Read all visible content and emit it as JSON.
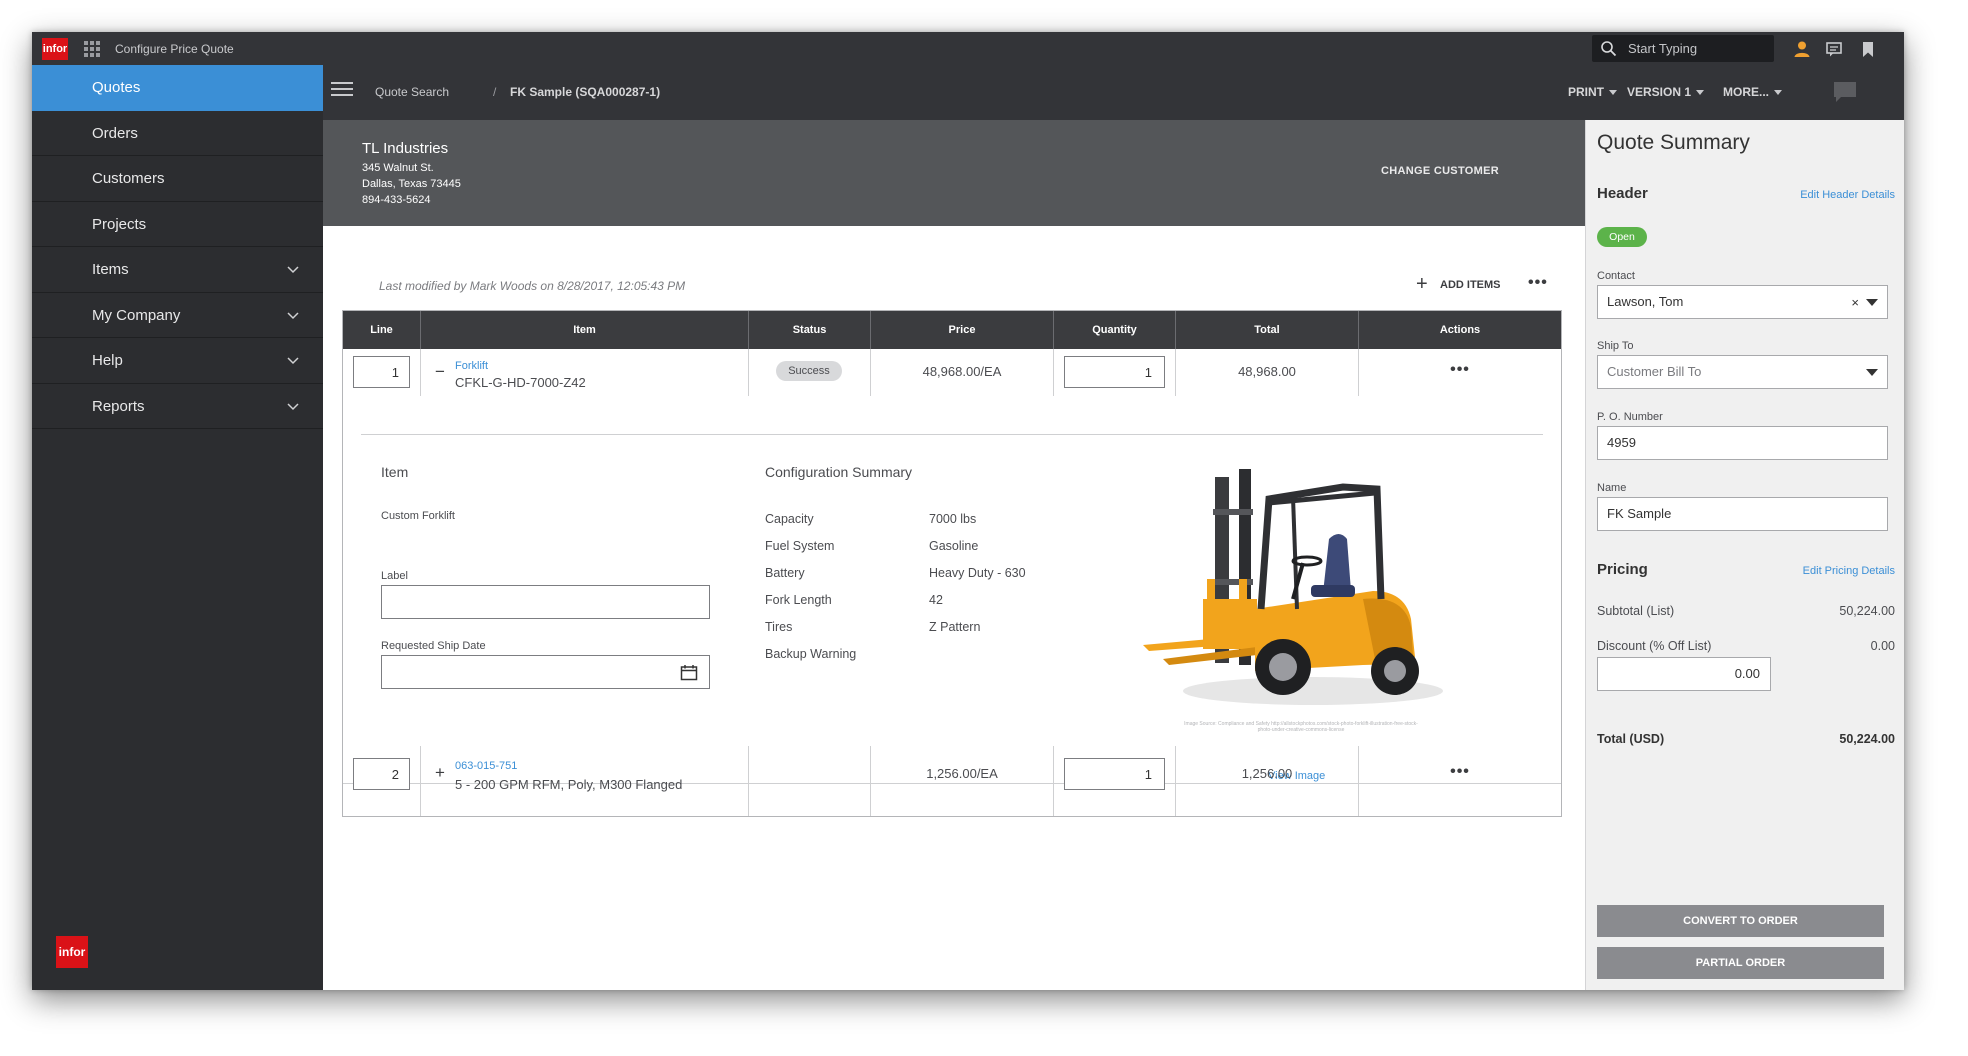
{
  "topbar": {
    "logo": "infor",
    "app_title": "Configure Price Quote",
    "search_placeholder": "Start Typing"
  },
  "sidebar": {
    "items": [
      {
        "label": "Quotes",
        "active": true,
        "expandable": false
      },
      {
        "label": "Orders",
        "active": false,
        "expandable": false
      },
      {
        "label": "Customers",
        "active": false,
        "expandable": false
      },
      {
        "label": "Projects",
        "active": false,
        "expandable": false
      },
      {
        "label": "Items",
        "active": false,
        "expandable": true
      },
      {
        "label": "My Company",
        "active": false,
        "expandable": true
      },
      {
        "label": "Help",
        "active": false,
        "expandable": true
      },
      {
        "label": "Reports",
        "active": false,
        "expandable": true
      }
    ],
    "logo": "infor"
  },
  "breadcrumb": {
    "parent": "Quote Search",
    "separator": "/",
    "current": "FK Sample (SQA000287-1)",
    "actions": [
      "PRINT",
      "VERSION 1",
      "MORE..."
    ]
  },
  "customer": {
    "name": "TL Industries",
    "address1": "345 Walnut St.",
    "address2": "Dallas, Texas 73445",
    "phone": "894-433-5624",
    "change_label": "CHANGE CUSTOMER"
  },
  "quote": {
    "last_modified": "Last modified by Mark Woods on 8/28/2017, 12:05:43 PM",
    "add_items_label": "ADD ITEMS",
    "more_label": "•••",
    "columns": [
      "Line",
      "Item",
      "Status",
      "Price",
      "Quantity",
      "Total",
      "Actions"
    ],
    "lines": [
      {
        "line": "1",
        "expander": "−",
        "item_link": "Forklift",
        "item_desc": "CFKL-G-HD-7000-Z42",
        "status": "Success",
        "price": "48,968.00/EA",
        "quantity": "1",
        "total": "48,968.00",
        "actions": "•••"
      },
      {
        "line": "2",
        "expander": "+",
        "item_link": "063-015-751",
        "item_desc": "5 - 200 GPM RFM, Poly, M300 Flanged",
        "status": "",
        "price": "1,256.00/EA",
        "quantity": "1",
        "total": "1,256.00",
        "actions": "•••"
      }
    ],
    "detail": {
      "item_heading": "Item",
      "item_name": "Custom Forklift",
      "label_label": "Label",
      "label_value": "",
      "ship_date_label": "Requested Ship Date",
      "ship_date_value": "",
      "config_heading": "Configuration Summary",
      "config": [
        {
          "key": "Capacity",
          "value": "7000 lbs"
        },
        {
          "key": "Fuel System",
          "value": "Gasoline"
        },
        {
          "key": "Battery",
          "value": "Heavy Duty - 630"
        },
        {
          "key": "Fork Length",
          "value": "42"
        },
        {
          "key": "Tires",
          "value": "Z Pattern"
        },
        {
          "key": "Backup Warning",
          "value": ""
        }
      ],
      "image_credit": "Image Source: Compliance and Safety\nhttp://allstockphotos.com/stock-photo-forklift-illustration-free-stock-photo-under-creative-commons-license",
      "view_image_label": "View Image"
    }
  },
  "summary": {
    "title": "Quote Summary",
    "header_heading": "Header",
    "edit_header_label": "Edit Header Details",
    "status_badge": "Open",
    "contact_label": "Contact",
    "contact_value": "Lawson, Tom",
    "ship_to_label": "Ship To",
    "ship_to_placeholder": "Customer Bill To",
    "po_label": "P. O. Number",
    "po_value": "4959",
    "name_label": "Name",
    "name_value": "FK Sample",
    "pricing_heading": "Pricing",
    "edit_pricing_label": "Edit Pricing Details",
    "subtotal_label": "Subtotal (List)",
    "subtotal_value": "50,224.00",
    "discount_label": "Discount (% Off List)",
    "discount_value": "0.00",
    "discount_input": "0.00",
    "total_label": "Total (USD)",
    "total_value": "50,224.00",
    "convert_label": "CONVERT TO ORDER",
    "partial_label": "PARTIAL ORDER"
  },
  "colors": {
    "accent": "#3b8fd6",
    "sidebar_bg": "#2c2d30",
    "topbar_bg": "#333438",
    "customer_band": "#545659",
    "success": "#5cb34a",
    "infor_red": "#da1217",
    "user_icon": "#f0a030"
  }
}
